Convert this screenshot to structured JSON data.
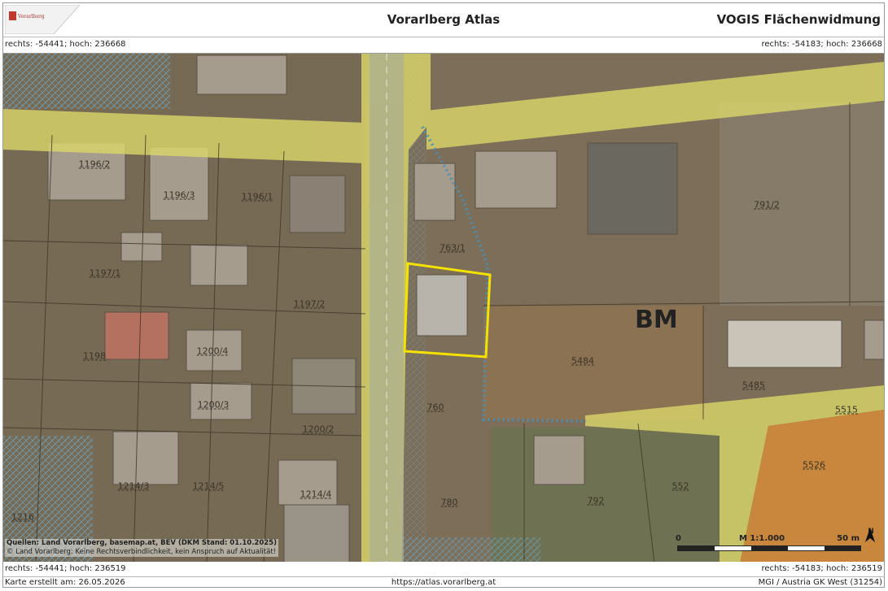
{
  "header": {
    "logo_text": "Vorarlberg",
    "title": "Vorarlberg Atlas",
    "map_title": "VOGIS Flächenwidmung"
  },
  "coords": {
    "top_left": "rechts: -54441; hoch: 236668",
    "top_right": "rechts: -54183; hoch: 236668",
    "bottom_left": "rechts: -54441; hoch: 236519",
    "bottom_right": "rechts: -54183; hoch: 236519"
  },
  "map": {
    "zone_label": "BM",
    "parcels": [
      "1196/2",
      "1196/3",
      "1196/1",
      "1197/1",
      "1197/2",
      "1198",
      "1200/4",
      "1200/3",
      "1200/2",
      "1214/3",
      "1214/5",
      "1214/4",
      "1216",
      "763/1",
      "760",
      "791/2",
      "5484",
      "5485",
      "5515",
      "5526",
      "552",
      "792",
      "780"
    ],
    "colors": {
      "road_zone": "#d9d46a",
      "selection": "#f5e200",
      "building_zone": "#b08a5d",
      "special_zone": "#d08a3a",
      "hatch_zone": "#6f9eb7"
    }
  },
  "source": {
    "line1_bold": "Quellen: Land Vorarlberg, basemap.at, BEV (DKM Stand: 01.10.2025)",
    "line2": "© Land Vorarlberg: Keine Rechtsverbindlichkeit, kein Anspruch auf Aktualität!"
  },
  "scale": {
    "start": "0",
    "ratio": "M 1:1.000",
    "end": "50 m",
    "north": "N"
  },
  "footer": {
    "created": "Karte erstellt am: 26.05.2026",
    "url": "https://atlas.vorarlberg.at",
    "projection": "MGI / Austria GK West (31254)"
  }
}
